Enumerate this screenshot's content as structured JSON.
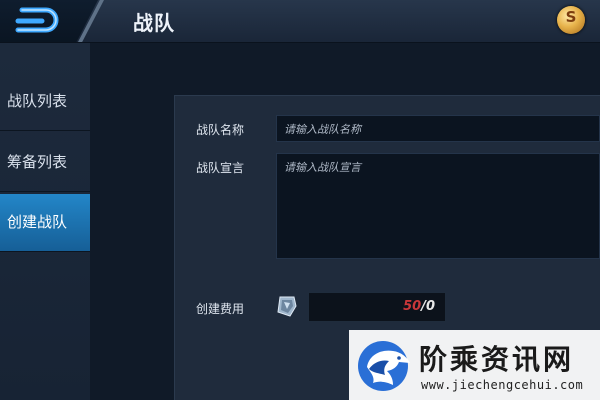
{
  "header": {
    "title": "战队",
    "back_icon": "back-arrow-icon",
    "currency_icon": "gold-coin-icon",
    "currency_glyph": "S"
  },
  "sidebar": {
    "items": [
      {
        "label": "战队列表",
        "active": false
      },
      {
        "label": "筹备列表",
        "active": false
      },
      {
        "label": "创建战队",
        "active": true
      }
    ]
  },
  "form": {
    "name_label": "战队名称",
    "name_placeholder": "请输入战队名称",
    "declaration_label": "战队宣言",
    "declaration_placeholder": "请输入战队宣言",
    "cost_label": "创建费用",
    "cost_current": "50",
    "cost_total": "/0",
    "cost_icon": "diamond-voucher-icon"
  },
  "watermark": {
    "name": "阶乘资讯网",
    "url": "www.jiechengcehui.com"
  },
  "colors": {
    "active_tab": "#1e78bb",
    "cost_current": "#c9373a",
    "background": "#142033"
  }
}
